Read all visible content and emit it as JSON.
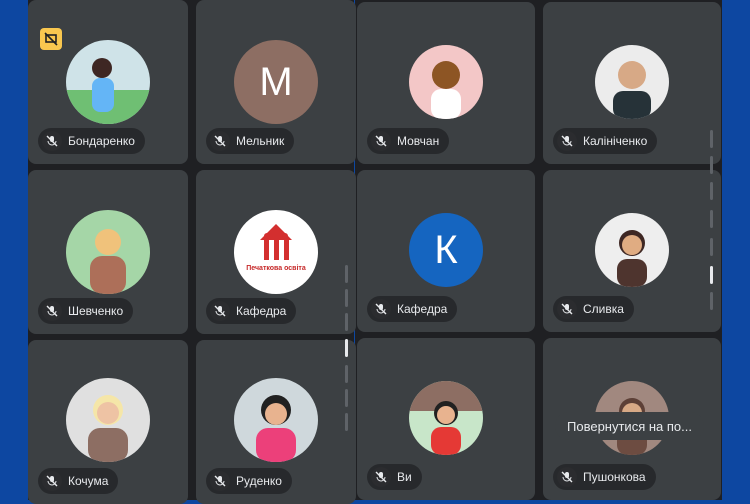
{
  "participants": [
    {
      "name": "Бондаренко"
    },
    {
      "name": "Мельник",
      "initial": "М"
    },
    {
      "name": "Мовчан"
    },
    {
      "name": "Калініченко"
    },
    {
      "name": "Шевченко"
    },
    {
      "name": "Кафедра",
      "logo_text": "Печаткова освіта"
    },
    {
      "name": "Кафедра",
      "initial": "К"
    },
    {
      "name": "Сливка"
    },
    {
      "name": "Кочума"
    },
    {
      "name": "Руденко"
    },
    {
      "name": "Ви"
    },
    {
      "name": "Пушонкова"
    }
  ],
  "tooltip": {
    "text": "Повернутися на по..."
  },
  "colors": {
    "background": "#0d47a1",
    "tile": "#3c4043",
    "avatar_m": "#8d6e63",
    "avatar_k": "#1565c0",
    "badge": "#f9c74f"
  }
}
